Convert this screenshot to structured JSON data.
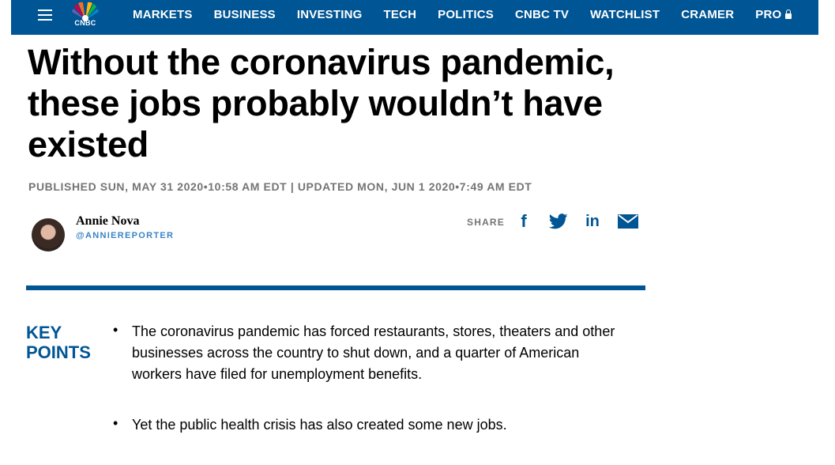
{
  "nav": {
    "logo_text": "CNBC",
    "items": [
      "MARKETS",
      "BUSINESS",
      "INVESTING",
      "TECH",
      "POLITICS",
      "CNBC TV",
      "WATCHLIST",
      "CRAMER",
      "PRO"
    ]
  },
  "article": {
    "headline": "Without the coronavirus pandemic, these jobs probably wouldn’t have existed",
    "dates": "PUBLISHED SUN, MAY 31 2020•10:58 AM EDT | UPDATED MON, JUN 1 2020•7:49 AM EDT",
    "author": {
      "name": "Annie Nova",
      "handle": "@ANNIEREPORTER"
    },
    "share_label": "SHARE",
    "key_points_title": "KEY POINTS",
    "key_points": [
      "The coronavirus pandemic has forced restaurants, stores, theaters and other businesses across the country to shut down, and a quarter of American workers have filed for unemployment benefits.",
      "Yet the public health crisis has also created some new jobs."
    ]
  },
  "colors": {
    "brand": "#005594",
    "meta": "#747474",
    "handle": "#3a84c4"
  },
  "icons": [
    "menu-icon",
    "cnbc-peacock-logo",
    "lock-icon",
    "facebook-icon",
    "twitter-icon",
    "linkedin-icon",
    "email-icon"
  ]
}
